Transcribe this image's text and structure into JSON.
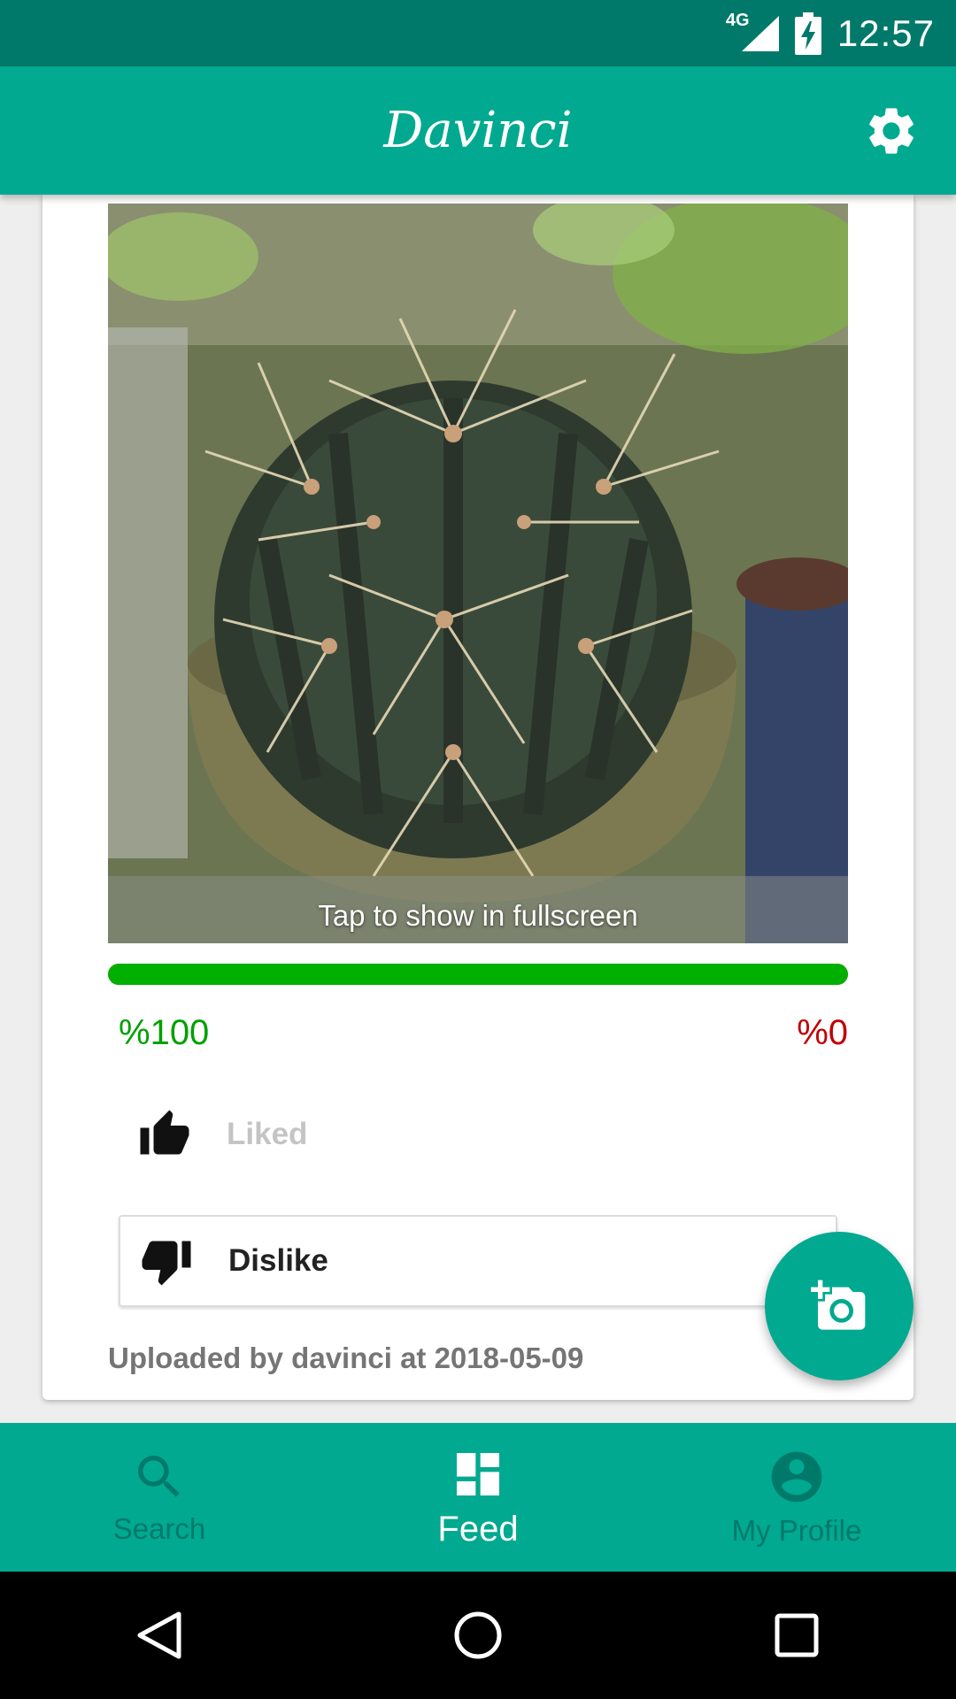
{
  "status_bar": {
    "network": "4G",
    "time": "12:57"
  },
  "app_bar": {
    "title": "Davinci",
    "settings_icon": "gear-icon"
  },
  "post": {
    "photo_caption": "Tap to show in fullscreen",
    "like_percent_label": "%100",
    "dislike_percent_label": "%0",
    "like_ratio": 1.0,
    "liked_label": "Liked",
    "dislike_label": "Dislike",
    "uploader_text": "Uploaded by davinci at 2018-05-09"
  },
  "fab": {
    "icon": "add-photo-icon"
  },
  "bottom_nav": {
    "items": [
      {
        "label": "Search",
        "icon": "search-icon",
        "active": false
      },
      {
        "label": "Feed",
        "icon": "dashboard-icon",
        "active": true
      },
      {
        "label": "My Profile",
        "icon": "account-circle-icon",
        "active": false
      }
    ]
  },
  "colors": {
    "primary": "#00a98f",
    "primary_dark": "#00796b",
    "like_green": "#00b000",
    "dislike_red": "#c00000"
  }
}
